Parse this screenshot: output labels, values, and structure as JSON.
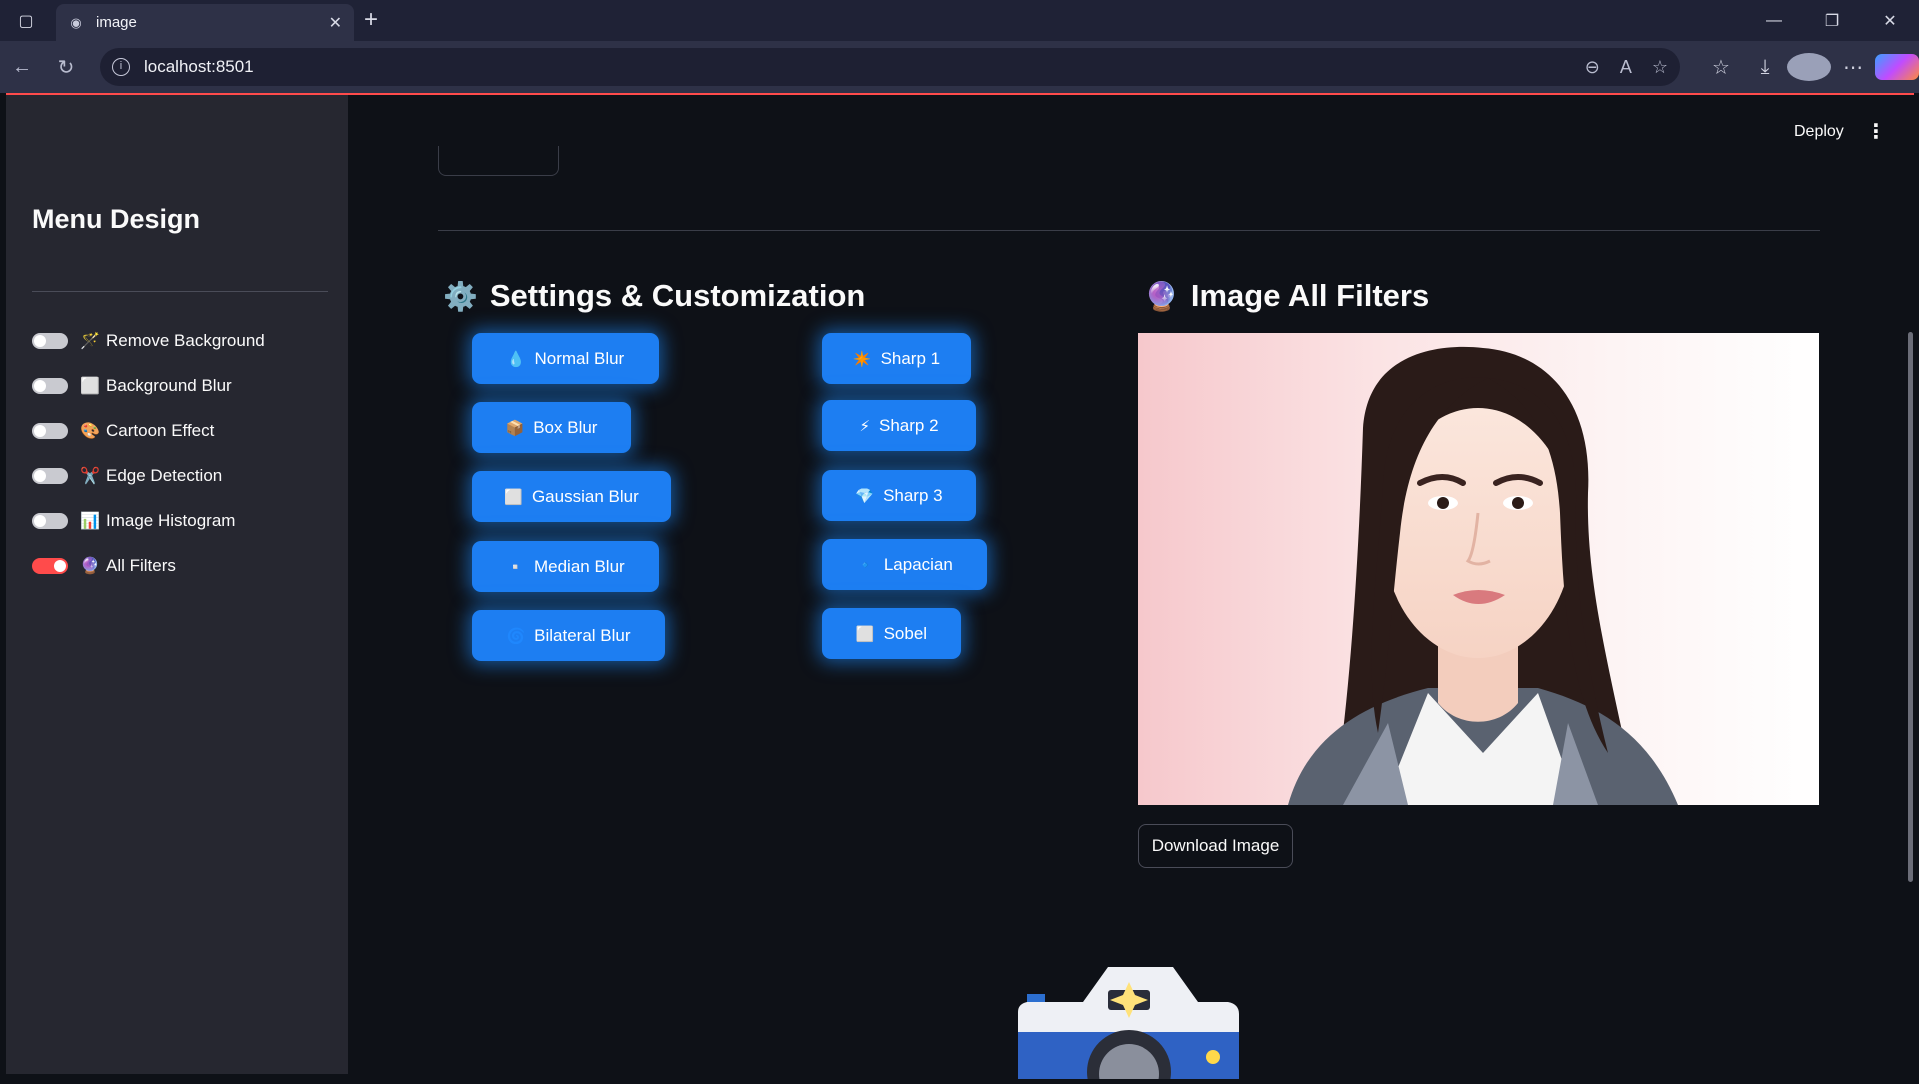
{
  "browser": {
    "tab_title": "image",
    "url": "localhost:8501",
    "tab_icon": "camera-icon"
  },
  "app": {
    "deploy_label": "Deploy",
    "menu_icon": "more-vertical-icon"
  },
  "sidebar": {
    "title": "Menu Design",
    "toggles": [
      {
        "emoji": "🪄",
        "label": "Remove Background",
        "on": false
      },
      {
        "emoji": "⬜",
        "label": "Background Blur",
        "on": false
      },
      {
        "emoji": "🎨",
        "label": "Cartoon Effect",
        "on": false
      },
      {
        "emoji": "✂️",
        "label": "Edge Detection",
        "on": false
      },
      {
        "emoji": "📊",
        "label": "Image Histogram",
        "on": false
      },
      {
        "emoji": "🔮",
        "label": "All Filters",
        "on": true
      }
    ]
  },
  "settings": {
    "icon": "⚙️",
    "title": "Settings & Customization",
    "blur_buttons": [
      {
        "emoji": "💧",
        "label": "Normal Blur"
      },
      {
        "emoji": "📦",
        "label": "Box Blur"
      },
      {
        "emoji": "⬜",
        "label": "Gaussian Blur"
      },
      {
        "emoji": "▫️",
        "label": "Median Blur"
      },
      {
        "emoji": "🌀",
        "label": "Bilateral Blur"
      }
    ],
    "sharp_buttons": [
      {
        "emoji": "✴️",
        "label": "Sharp 1"
      },
      {
        "emoji": "⚡",
        "label": "Sharp 2"
      },
      {
        "emoji": "💎",
        "label": "Sharp 3"
      },
      {
        "emoji": "🔹",
        "label": "Lapacian"
      },
      {
        "emoji": "⬜",
        "label": "Sobel"
      }
    ]
  },
  "filters": {
    "icon": "🔮",
    "title": "Image All Filters",
    "download_label": "Download Image"
  }
}
